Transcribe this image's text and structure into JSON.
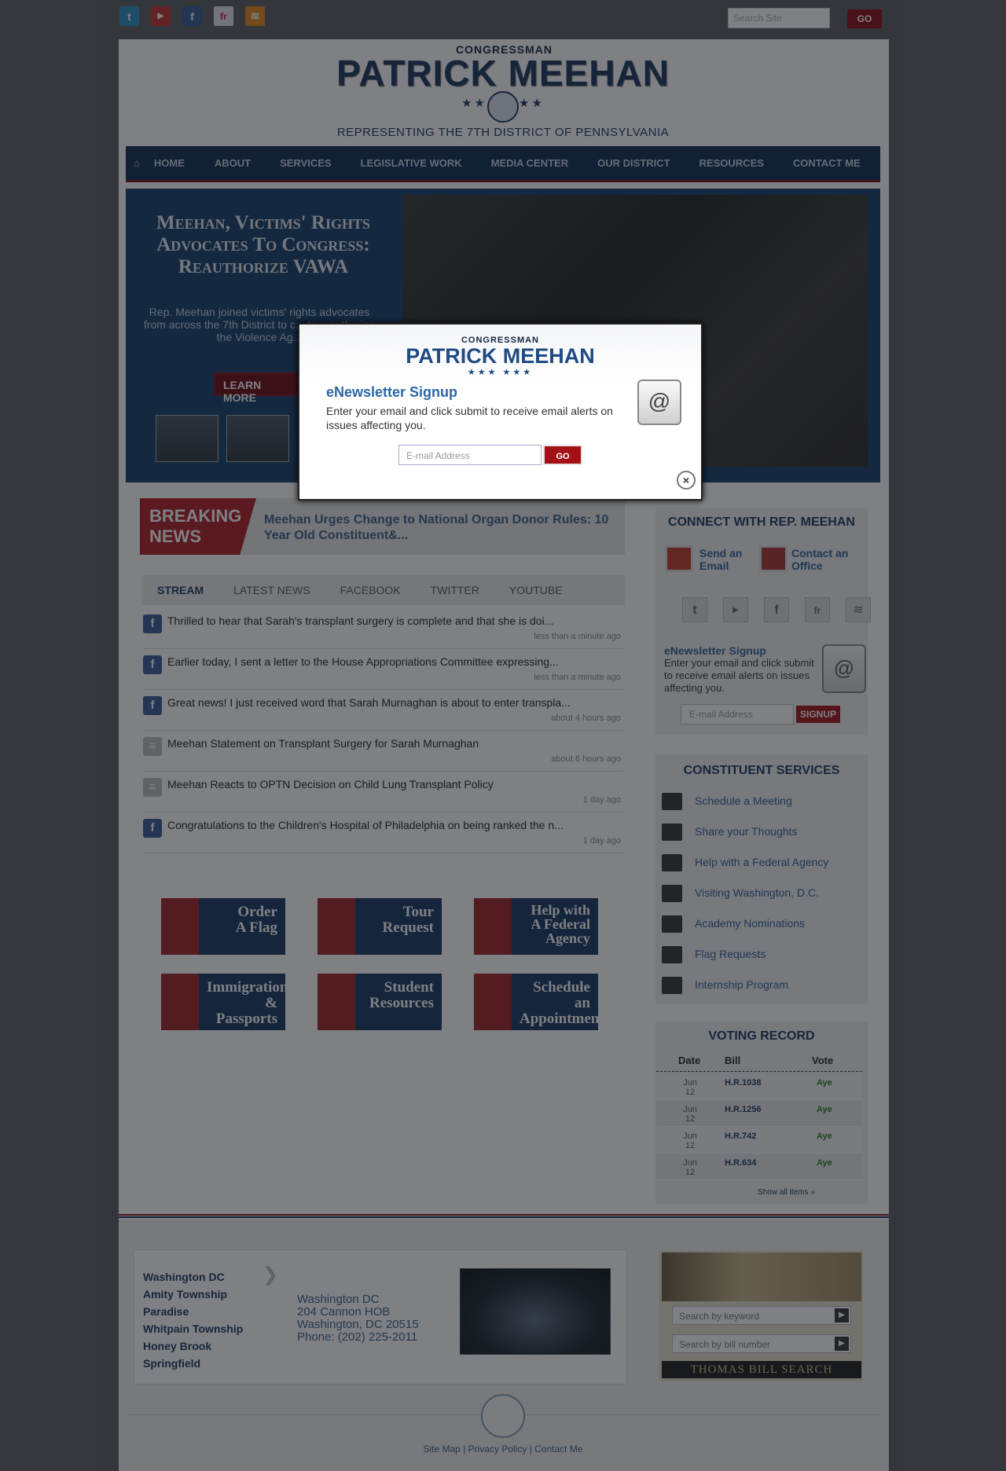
{
  "topbar": {
    "search_placeholder": "Search Site",
    "go_label": "GO",
    "social": [
      {
        "icon": "twitter-icon",
        "glyph": "t",
        "color": "#2f8fc5"
      },
      {
        "icon": "youtube-icon",
        "glyph": "▶",
        "color": "#c4302b"
      },
      {
        "icon": "facebook-icon",
        "glyph": "f",
        "color": "#3b5998"
      },
      {
        "icon": "flickr-icon",
        "glyph": "fr",
        "color": "#e6e6e6"
      },
      {
        "icon": "rss-icon",
        "glyph": "≋",
        "color": "#e88b1d"
      }
    ]
  },
  "header": {
    "congressman": "CONGRESSMAN",
    "name": "PATRICK MEEHAN",
    "stars": "★★★   ★★★",
    "subtitle": "REPRESENTING THE 7TH DISTRICT OF PENNSYLVANIA"
  },
  "nav": {
    "items": [
      "HOME",
      "ABOUT",
      "SERVICES",
      "LEGISLATIVE WORK",
      "MEDIA CENTER",
      "OUR DISTRICT",
      "RESOURCES",
      "CONTACT ME"
    ]
  },
  "hero": {
    "title": "Meehan, Victims' Rights Advocates To Congress: Reauthorize VAWA",
    "text": "Rep. Meehan joined victims' rights advocates from across the 7th District to c... to reauthorize the Violence Ag...",
    "button": "LEARN MORE"
  },
  "breaking": {
    "label_line1": "BREAKING",
    "label_line2": "NEWS",
    "headline": "Meehan Urges Change to National Organ Donor Rules: 10 Year Old Constituent&..."
  },
  "stream": {
    "tabs": [
      "STREAM",
      "LATEST NEWS",
      "FACEBOOK",
      "TWITTER",
      "YOUTUBE"
    ],
    "items": [
      {
        "type": "facebook",
        "text": "Thrilled to hear that Sarah's transplant surgery is complete and that she is doi...",
        "time": "less than a minute ago"
      },
      {
        "type": "facebook",
        "text": "Earlier today, I sent a letter to the House Appropriations Committee expressing...",
        "time": "less than a minute ago"
      },
      {
        "type": "facebook",
        "text": "Great news! I just received word that Sarah Murnaghan is about to enter transpla...",
        "time": "about 4 hours ago"
      },
      {
        "type": "news",
        "text": "Meehan Statement on Transplant Surgery for Sarah Murnaghan",
        "time": "about 6 hours ago"
      },
      {
        "type": "news",
        "text": "Meehan Reacts to OPTN Decision on Child Lung Transplant Policy",
        "time": "1 day ago"
      },
      {
        "type": "facebook",
        "text": "Congratulations to the Children's Hospital of Philadelphia on being ranked the n...",
        "time": "1 day ago"
      }
    ]
  },
  "tiles": [
    {
      "line1": "Order",
      "line2": "A Flag",
      "line3": ""
    },
    {
      "line1": "Tour",
      "line2": "Request",
      "line3": ""
    },
    {
      "line1": "Help with",
      "line2": "A Federal",
      "line3": "Agency"
    },
    {
      "line1": "Immigration",
      "line2": "& Passports",
      "line3": ""
    },
    {
      "line1": "Student",
      "line2": "Resources",
      "line3": ""
    },
    {
      "line1": "Schedule an",
      "line2": "Appointment",
      "line3": ""
    }
  ],
  "connect": {
    "title": "CONNECT WITH REP. MEEHAN",
    "email_line1": "Send an",
    "email_line2": "Email",
    "office_line1": "Contact an",
    "office_line2": "Office",
    "enews_title": "eNewsletter Signup",
    "enews_text": "Enter your email and click submit to receive email alerts on issues affecting you.",
    "enews_placeholder": "E-mail Address",
    "enews_button": "SIGNUP"
  },
  "services": {
    "title": "CONSTITUENT SERVICES",
    "items": [
      "Schedule a Meeting",
      "Share your Thoughts",
      "Help with a Federal Agency",
      "Visiting Washington, D.C.",
      "Academy Nominations",
      "Flag Requests",
      "Internship Program"
    ]
  },
  "voting": {
    "title": "VOTING RECORD",
    "headers": [
      "Date",
      "Bill",
      "Vote"
    ],
    "rows": [
      {
        "month": "Jun",
        "day": "12",
        "bill": "H.R.1038",
        "vote": "Aye"
      },
      {
        "month": "Jun",
        "day": "12",
        "bill": "H.R.1256",
        "vote": "Aye"
      },
      {
        "month": "Jun",
        "day": "12",
        "bill": "H.R.742",
        "vote": "Aye"
      },
      {
        "month": "Jun",
        "day": "12",
        "bill": "H.R.634",
        "vote": "Aye"
      }
    ],
    "show_all": "Show all items »"
  },
  "footer": {
    "offices": [
      "Washington DC",
      "Amity Township",
      "Paradise",
      "Whitpain Township",
      "Honey Brook",
      "Springfield"
    ],
    "address": {
      "line1": "Washington DC",
      "line2": "204 Cannon HOB",
      "line3": "Washington, DC 20515",
      "line4": "Phone: (202) 225-2011"
    },
    "thomas": {
      "keyword_placeholder": "Search by keyword",
      "bill_placeholder": "Search by bill number",
      "label": "THOMAS BILL SEARCH"
    },
    "links": {
      "sitemap": "Site Map",
      "privacy": "Privacy Policy",
      "contact": "Contact Me",
      "sep": "|"
    }
  },
  "modal": {
    "congressman": "CONGRESSMAN",
    "name": "PATRICK MEEHAN",
    "stars": "★★★      ★★★",
    "title": "eNewsletter Signup",
    "text": "Enter your email and click submit to receive email alerts on issues affecting you.",
    "placeholder": "E-mail Address",
    "go": "GO",
    "close": "×"
  }
}
